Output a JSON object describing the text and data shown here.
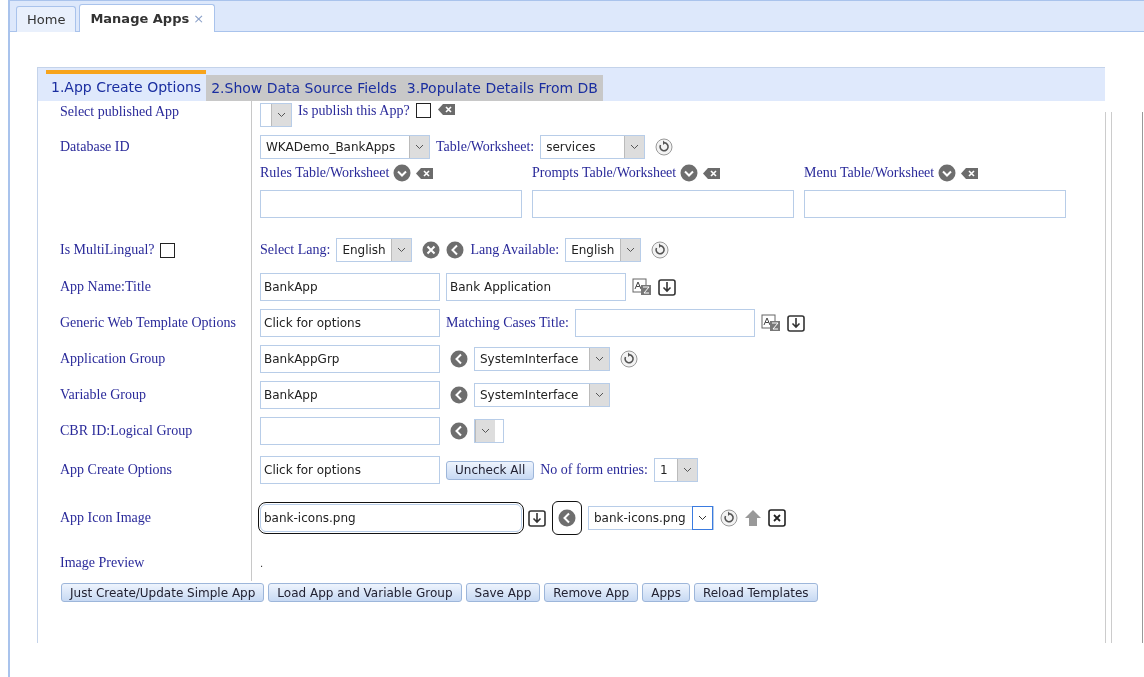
{
  "tabs": [
    {
      "label": "Home",
      "selected": false
    },
    {
      "label": "Manage Apps",
      "selected": true,
      "close": "×"
    }
  ],
  "steps": [
    {
      "label": "1.App Create Options",
      "selected": true
    },
    {
      "label": "2.Show Data Source Fields",
      "selected": false
    },
    {
      "label": "3.Populate Details From DB",
      "selected": false
    }
  ],
  "published": {
    "label": "Select published App",
    "question": "Is publish this App?",
    "checked": false
  },
  "database": {
    "label": "Database ID",
    "db": "WKADemo_BankApps",
    "table_label": "Table/Worksheet:",
    "table": "services",
    "sub_tables": [
      {
        "label": "Rules Table/Worksheet"
      },
      {
        "label": "Prompts Table/Worksheet"
      },
      {
        "label": "Menu Table/Worksheet"
      }
    ]
  },
  "multilingual": {
    "label": "Is MultiLingual?",
    "checked": false,
    "select_label": "Select Lang:",
    "lang": "English",
    "available_label": "Lang Available:",
    "available": "English"
  },
  "app_name": {
    "label": "App Name:Title",
    "name": "BankApp",
    "title": "Bank Application"
  },
  "template": {
    "label": "Generic Web Template Options",
    "value": "Click for options",
    "cases_label": "Matching Cases Title:"
  },
  "groups": [
    {
      "label": "Application Group",
      "value": "BankAppGrp",
      "select": "SystemInterface",
      "refresh": true
    },
    {
      "label": "Variable Group",
      "value": "BankApp",
      "select": "SystemInterface",
      "refresh": false
    },
    {
      "label": "CBR ID:Logical Group",
      "refresh": false
    }
  ],
  "create_options": {
    "label": "App Create Options",
    "value": "Click for options",
    "button": "Uncheck All",
    "entries_label": "No of form entries:",
    "entries": "1"
  },
  "icon": {
    "label": "App Icon Image",
    "value": "bank-icons.png",
    "select": "bank-icons.png",
    "highlighted": true
  },
  "preview": {
    "label": "Image Preview",
    "value": "."
  },
  "buttons": [
    "Just Create/Update Simple App",
    "Load App and Variable Group",
    "Save App",
    "Remove App",
    "Apps",
    "Reload Templates"
  ]
}
